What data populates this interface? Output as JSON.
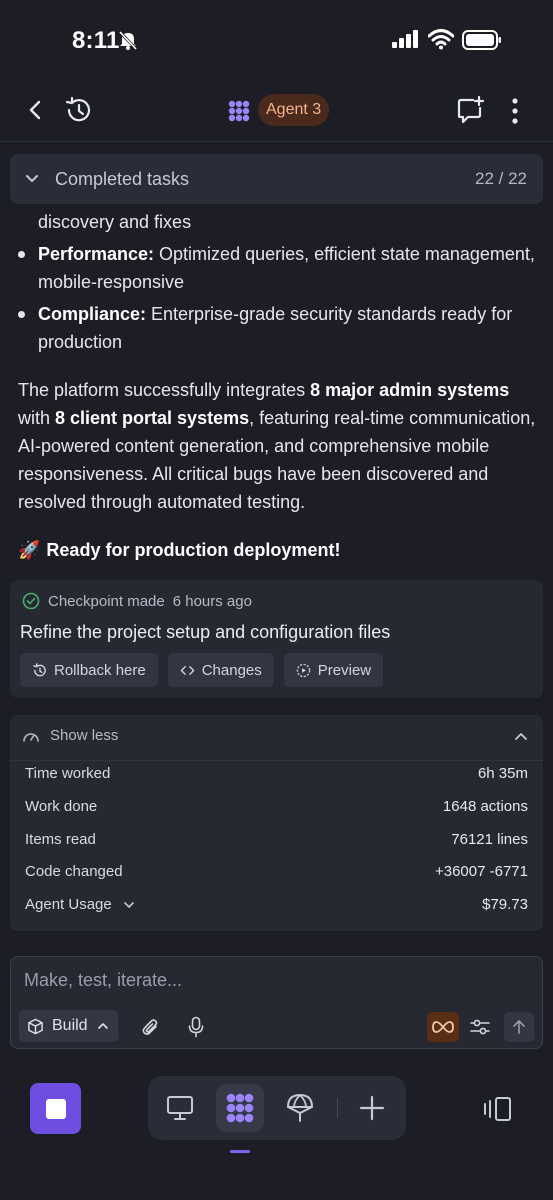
{
  "status_bar": {
    "time": "8:11"
  },
  "header": {
    "agent_name": "Agent 3"
  },
  "tasks": {
    "label": "Completed tasks",
    "count": "22 / 22"
  },
  "message": {
    "first_line": "discovery and fixes",
    "bullets": [
      {
        "bold": "Performance:",
        "text": " Optimized queries, efficient state management, mobile-responsive"
      },
      {
        "bold": "Compliance:",
        "text": " Enterprise-grade security standards ready for production"
      }
    ],
    "para_1": "The platform successfully integrates ",
    "para_bold_1": "8 major admin systems",
    "para_2": " with ",
    "para_bold_2": "8 client portal systems",
    "para_3": ", featuring real-time communication, AI-powered content generation, and comprehensive mobile responsiveness. All critical bugs have been discovered and resolved through automated testing.",
    "ready_emoji": "🚀",
    "ready_text": "Ready for production deployment!"
  },
  "checkpoint": {
    "label": "Checkpoint made",
    "time": "6 hours ago",
    "title": "Refine the project setup and configuration files",
    "buttons": {
      "rollback": "Rollback here",
      "changes": "Changes",
      "preview": "Preview"
    }
  },
  "stats": {
    "toggle_label": "Show less",
    "rows": [
      {
        "key": "Time worked",
        "value": "6h 35m"
      },
      {
        "key": "Work done",
        "value": "1648 actions"
      },
      {
        "key": "Items read",
        "value": "76121 lines"
      },
      {
        "key": "Code changed",
        "value": "+36007 -6771"
      },
      {
        "key": "Agent Usage",
        "value": "$79.73"
      }
    ]
  },
  "composer": {
    "placeholder": "Make, test, iterate...",
    "mode": "Build"
  },
  "colors": {
    "accent": "#6d4ee0",
    "agent_pill_bg": "#4a2a1c",
    "agent_pill_text": "#f5b48a",
    "success": "#4caf6a"
  },
  "icons": [
    "back-icon",
    "history-icon",
    "agent-icon",
    "new-chat-icon",
    "more-icon",
    "chevron-down-icon",
    "check-circle-icon",
    "rollback-icon",
    "code-icon",
    "preview-icon",
    "gauge-icon",
    "chevron-up-icon",
    "cube-icon",
    "paperclip-icon",
    "mic-icon",
    "infinity-icon",
    "sliders-icon",
    "arrow-up-icon",
    "stop-icon",
    "monitor-icon",
    "deploy-icon",
    "plus-icon",
    "panel-icon"
  ]
}
